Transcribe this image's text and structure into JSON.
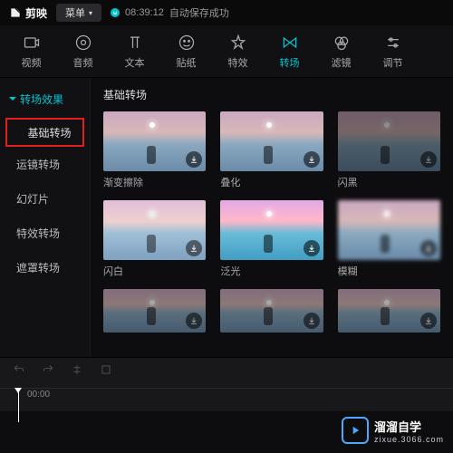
{
  "titlebar": {
    "app_name": "剪映",
    "menu_label": "菜单",
    "autosave_time": "08:39:12",
    "autosave_text": "自动保存成功"
  },
  "toolbar": [
    {
      "id": "video",
      "label": "视频"
    },
    {
      "id": "audio",
      "label": "音频"
    },
    {
      "id": "text",
      "label": "文本"
    },
    {
      "id": "sticker",
      "label": "贴纸"
    },
    {
      "id": "effect",
      "label": "特效"
    },
    {
      "id": "transition",
      "label": "转场",
      "active": true
    },
    {
      "id": "filter",
      "label": "滤镜"
    },
    {
      "id": "adjust",
      "label": "调节"
    }
  ],
  "sidebar": {
    "header": "转场效果",
    "items": [
      {
        "label": "基础转场",
        "selected": true
      },
      {
        "label": "运镜转场"
      },
      {
        "label": "幻灯片"
      },
      {
        "label": "特效转场"
      },
      {
        "label": "遮罩转场"
      }
    ]
  },
  "content": {
    "section_title": "基础转场",
    "thumbs": [
      {
        "label": "渐变擦除",
        "cls": "sunset"
      },
      {
        "label": "叠化",
        "cls": "sunset normal-sunset"
      },
      {
        "label": "闪黑",
        "cls": "sunset dark-sunset"
      },
      {
        "label": "闪白",
        "cls": "sunset bright-sunset"
      },
      {
        "label": "泛光",
        "cls": "sunset sat-sunset"
      },
      {
        "label": "模糊",
        "cls": "sunset blur-sunset"
      },
      {
        "label": "",
        "cls": "sunset dim-sunset row2thumb"
      },
      {
        "label": "",
        "cls": "sunset dim-sunset row2thumb"
      },
      {
        "label": "",
        "cls": "sunset dim-sunset row2thumb"
      }
    ]
  },
  "timeline": {
    "time": "00:00"
  },
  "watermark": {
    "brand": "溜溜自学",
    "url": "zixue.3066.com"
  }
}
